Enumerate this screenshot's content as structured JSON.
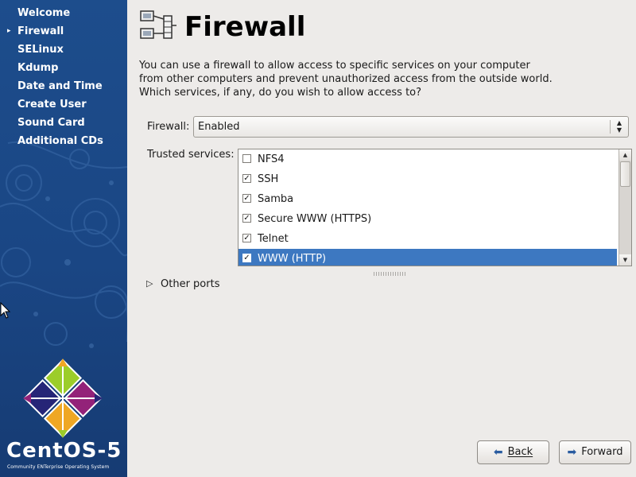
{
  "sidebar": {
    "items": [
      {
        "label": "Welcome",
        "current": false
      },
      {
        "label": "Firewall",
        "current": true
      },
      {
        "label": "SELinux",
        "current": false
      },
      {
        "label": "Kdump",
        "current": false
      },
      {
        "label": "Date and Time",
        "current": false
      },
      {
        "label": "Create User",
        "current": false
      },
      {
        "label": "Sound Card",
        "current": false
      },
      {
        "label": "Additional CDs",
        "current": false
      }
    ],
    "brand": "CentOS-5",
    "brand_tagline": "Community ENTerprise Operating System"
  },
  "page": {
    "title": "Firewall",
    "intro": "You can use a firewall to allow access to specific services on your computer from other computers and prevent unauthorized access from the outside world.  Which services, if any, do you wish to allow access to?"
  },
  "firewall": {
    "label": "Firewall:",
    "value": "Enabled"
  },
  "trusted_services": {
    "label": "Trusted services:",
    "items": [
      {
        "label": "NFS4",
        "checked": false,
        "selected": false
      },
      {
        "label": "SSH",
        "checked": true,
        "selected": false
      },
      {
        "label": "Samba",
        "checked": true,
        "selected": false
      },
      {
        "label": "Secure WWW (HTTPS)",
        "checked": true,
        "selected": false
      },
      {
        "label": "Telnet",
        "checked": true,
        "selected": false
      },
      {
        "label": "WWW (HTTP)",
        "checked": true,
        "selected": true
      }
    ]
  },
  "other_ports": {
    "label": "Other ports"
  },
  "buttons": {
    "back": "Back",
    "forward": "Forward"
  },
  "colors": {
    "sidebar": "#1d4d8c",
    "selection": "#3d78c1",
    "window": "#edebe9"
  },
  "icons": {
    "title": "network-firewall-icon",
    "back": "arrow-left-icon",
    "forward": "arrow-right-icon"
  }
}
